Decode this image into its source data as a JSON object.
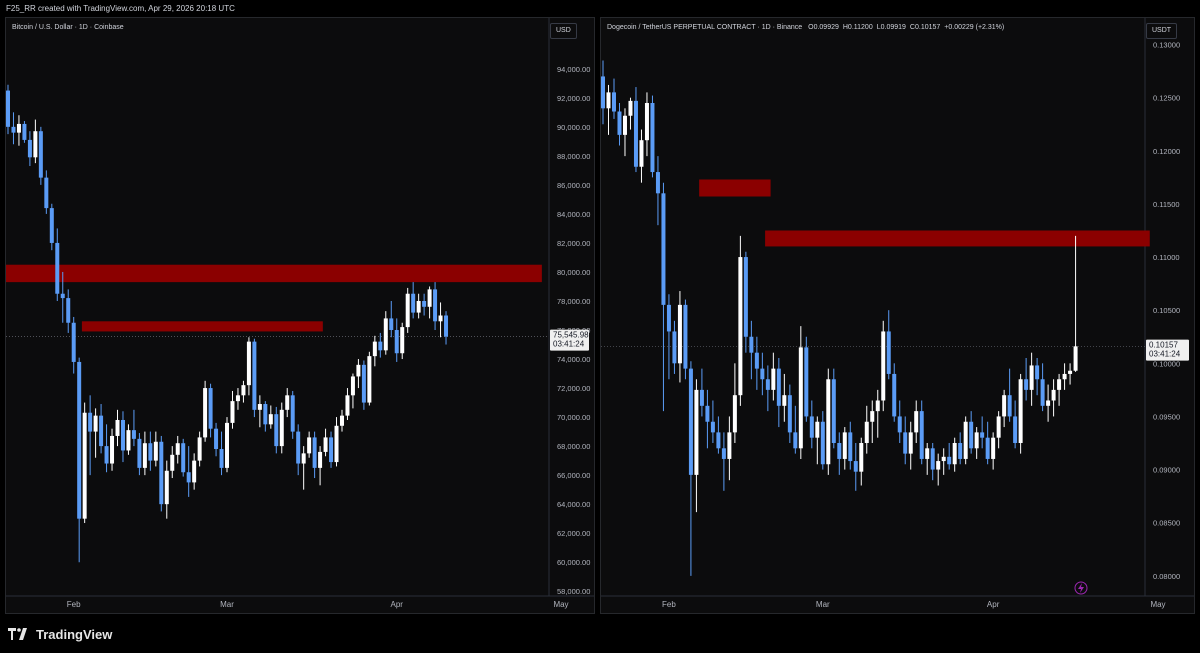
{
  "header": {
    "text": "F25_RR created with TradingView.com, Apr 29, 2026 20:18 UTC"
  },
  "footer": {
    "brand": "TradingView",
    "logo_icon": "tradingview-logo-icon"
  },
  "colors": {
    "up": "#ffffff",
    "down": "#5b9cf6",
    "zone": "#8b0000",
    "background": "#0c0c0d",
    "axis_text": "#b2b5be"
  },
  "chart_data": [
    {
      "type": "candlestick",
      "title": "Bitcoin / U.S. Dollar · 1D · Coinbase",
      "currency": "USD",
      "ylim": [
        56500,
        97500
      ],
      "y_ticks": [
        58000,
        60000,
        62000,
        64000,
        66000,
        68000,
        70000,
        72000,
        74000,
        76000,
        78000,
        80000,
        82000,
        84000,
        86000,
        88000,
        90000,
        92000,
        94000
      ],
      "y_tick_labels": [
        "58,000.00",
        "60,000.00",
        "62,000.00",
        "64,000.00",
        "66,000.00",
        "68,000.00",
        "70,000.00",
        "72,000.00",
        "74,000.00",
        "76,000.00",
        "78,000.00",
        "80,000.00",
        "82,000.00",
        "84,000.00",
        "86,000.00",
        "88,000.00",
        "90,000.00",
        "92,000.00",
        "94,000.00"
      ],
      "x_ticks": [
        {
          "date": "2026-02-01",
          "label": "Feb"
        },
        {
          "date": "2026-03-01",
          "label": "Mar"
        },
        {
          "date": "2026-04-01",
          "label": "Apr"
        },
        {
          "date": "2026-05-01",
          "label": "May"
        }
      ],
      "date_range": [
        "2026-01-20",
        "2026-05-01"
      ],
      "first_date": "2026-01-20",
      "last_price": {
        "value": 75545.98,
        "label": "75,545.98",
        "countdown": "03:41:24"
      },
      "zones": [
        {
          "from": "2026-01-20",
          "to": "2026-04-27",
          "low": 79300,
          "high": 80500
        },
        {
          "from": "2026-02-03",
          "to": "2026-03-18",
          "low": 75900,
          "high": 76600
        }
      ],
      "ohlc": [
        [
          92500,
          92900,
          89500,
          90000
        ],
        [
          90000,
          91000,
          88800,
          89600
        ],
        [
          89600,
          90800,
          88700,
          90200
        ],
        [
          90200,
          90400,
          88900,
          89100
        ],
        [
          89100,
          89700,
          87300,
          87900
        ],
        [
          87900,
          90500,
          87500,
          89700
        ],
        [
          89700,
          90000,
          86000,
          86500
        ],
        [
          86500,
          87000,
          84000,
          84400
        ],
        [
          84400,
          84700,
          81500,
          82000
        ],
        [
          82000,
          83000,
          78000,
          78500
        ],
        [
          78500,
          80000,
          76500,
          78200
        ],
        [
          78200,
          78800,
          75800,
          76500
        ],
        [
          76500,
          76900,
          73000,
          73800
        ],
        [
          73800,
          74100,
          60000,
          63000
        ],
        [
          63000,
          71000,
          62700,
          70300
        ],
        [
          70300,
          71500,
          66000,
          69000
        ],
        [
          69000,
          70600,
          67200,
          70100
        ],
        [
          70100,
          70900,
          67500,
          68000
        ],
        [
          68000,
          69500,
          66200,
          66800
        ],
        [
          66800,
          69200,
          66300,
          68700
        ],
        [
          68700,
          70500,
          68000,
          69800
        ],
        [
          69800,
          70400,
          66900,
          67700
        ],
        [
          67700,
          69500,
          67400,
          69100
        ],
        [
          69100,
          70500,
          68000,
          68500
        ],
        [
          68500,
          68900,
          66000,
          66500
        ],
        [
          66500,
          69000,
          66000,
          68200
        ],
        [
          68200,
          69000,
          66300,
          67000
        ],
        [
          67000,
          69000,
          66600,
          68300
        ],
        [
          68300,
          68700,
          63500,
          64000
        ],
        [
          64000,
          67000,
          63000,
          66300
        ],
        [
          66300,
          68000,
          65800,
          67400
        ],
        [
          67400,
          68700,
          66800,
          68200
        ],
        [
          68200,
          68500,
          65900,
          66200
        ],
        [
          66200,
          68000,
          64500,
          65500
        ],
        [
          65500,
          67500,
          65000,
          67000
        ],
        [
          67000,
          69000,
          66600,
          68600
        ],
        [
          68600,
          72500,
          68300,
          72000
        ],
        [
          72000,
          72300,
          68600,
          69200
        ],
        [
          69200,
          69600,
          67300,
          67800
        ],
        [
          67800,
          69000,
          66000,
          66500
        ],
        [
          66500,
          70000,
          66200,
          69600
        ],
        [
          69600,
          71800,
          69200,
          71100
        ],
        [
          71100,
          72000,
          70500,
          71500
        ],
        [
          71500,
          72500,
          71000,
          72200
        ],
        [
          72200,
          75500,
          71500,
          75200
        ],
        [
          75200,
          75400,
          70000,
          70500
        ],
        [
          70500,
          71500,
          69300,
          70900
        ],
        [
          70900,
          71100,
          69000,
          69500
        ],
        [
          69500,
          70800,
          69200,
          70200
        ],
        [
          70200,
          70700,
          67500,
          68000
        ],
        [
          68000,
          71000,
          67500,
          70500
        ],
        [
          70500,
          72000,
          70000,
          71500
        ],
        [
          71500,
          71800,
          68500,
          69000
        ],
        [
          69000,
          69500,
          66000,
          66800
        ],
        [
          66800,
          68000,
          65000,
          67500
        ],
        [
          67500,
          69000,
          67200,
          68600
        ],
        [
          68600,
          69000,
          65800,
          66500
        ],
        [
          66500,
          68000,
          65300,
          67600
        ],
        [
          67600,
          69200,
          67300,
          68600
        ],
        [
          68600,
          69000,
          66500,
          66900
        ],
        [
          66900,
          70000,
          66600,
          69400
        ],
        [
          69400,
          70500,
          69000,
          70100
        ],
        [
          70100,
          72000,
          69800,
          71500
        ],
        [
          71500,
          73000,
          70600,
          72800
        ],
        [
          72800,
          74000,
          72000,
          73600
        ],
        [
          73600,
          73900,
          70500,
          71000
        ],
        [
          71000,
          74500,
          70800,
          74200
        ],
        [
          74200,
          75600,
          73500,
          75200
        ],
        [
          75200,
          75800,
          74100,
          74600
        ],
        [
          74600,
          77300,
          74300,
          76800
        ],
        [
          76800,
          78000,
          75500,
          76000
        ],
        [
          76000,
          76800,
          73800,
          74400
        ],
        [
          74400,
          76500,
          74000,
          76200
        ],
        [
          76200,
          78900,
          75800,
          78500
        ],
        [
          78500,
          79300,
          76800,
          77200
        ],
        [
          77200,
          78500,
          76800,
          78000
        ],
        [
          78000,
          78500,
          77000,
          77600
        ],
        [
          77600,
          79000,
          76800,
          78800
        ],
        [
          78800,
          79300,
          76000,
          76600
        ],
        [
          76600,
          77900,
          75500,
          77000
        ],
        [
          77000,
          77300,
          75000,
          75546
        ]
      ]
    },
    {
      "type": "candlestick",
      "title": "Dogecoin / TetherUS PERPETUAL CONTRACT · 1D · Binance",
      "ohlc_text": [
        {
          "k": "O",
          "v": "0.09929"
        },
        {
          "k": "H",
          "v": "0.11200"
        },
        {
          "k": "L",
          "v": "0.09919"
        },
        {
          "k": "C",
          "v": "0.10157"
        },
        {
          "k": "chg",
          "v": "+0.00229 (+2.31%)"
        }
      ],
      "currency": "USDT",
      "ylim": [
        0.0765,
        0.1325
      ],
      "y_ticks": [
        0.08,
        0.085,
        0.09,
        0.095,
        0.1,
        0.105,
        0.11,
        0.115,
        0.12,
        0.125,
        0.13
      ],
      "y_tick_labels": [
        "0.08000",
        "0.08500",
        "0.09000",
        "0.09500",
        "0.10000",
        "0.10500",
        "0.11000",
        "0.11500",
        "0.12000",
        "0.12500",
        "0.13000"
      ],
      "x_ticks": [
        {
          "date": "2026-02-01",
          "label": "Feb"
        },
        {
          "date": "2026-03-01",
          "label": "Mar"
        },
        {
          "date": "2026-04-01",
          "label": "Apr"
        },
        {
          "date": "2026-05-01",
          "label": "May"
        }
      ],
      "date_range": [
        "2026-01-20",
        "2026-05-01"
      ],
      "first_date": "2026-01-20",
      "last_price": {
        "value": 0.10157,
        "label": "0.10157",
        "countdown": "03:41:24"
      },
      "alert_icon": "lightning-icon",
      "zones": [
        {
          "from": "2026-02-07",
          "to": "2026-02-19",
          "low": 0.1157,
          "high": 0.1173
        },
        {
          "from": "2026-02-19",
          "to": "2026-04-29",
          "low": 0.111,
          "high": 0.1125
        }
      ],
      "ohlc": [
        [
          0.127,
          0.1285,
          0.1225,
          0.124
        ],
        [
          0.124,
          0.1262,
          0.1215,
          0.1255
        ],
        [
          0.1255,
          0.1268,
          0.123,
          0.1237
        ],
        [
          0.1237,
          0.1245,
          0.1205,
          0.1215
        ],
        [
          0.1215,
          0.124,
          0.1195,
          0.1233
        ],
        [
          0.1233,
          0.125,
          0.122,
          0.1247
        ],
        [
          0.1247,
          0.126,
          0.118,
          0.1185
        ],
        [
          0.1185,
          0.122,
          0.117,
          0.121
        ],
        [
          0.121,
          0.1255,
          0.1195,
          0.1245
        ],
        [
          0.1245,
          0.1252,
          0.1175,
          0.118
        ],
        [
          0.118,
          0.1195,
          0.113,
          0.116
        ],
        [
          0.116,
          0.117,
          0.0955,
          0.1055
        ],
        [
          0.1055,
          0.1065,
          0.0985,
          0.103
        ],
        [
          0.103,
          0.104,
          0.099,
          0.1
        ],
        [
          0.1,
          0.1068,
          0.0982,
          0.1055
        ],
        [
          0.1055,
          0.106,
          0.0985,
          0.0995
        ],
        [
          0.0995,
          0.1002,
          0.08,
          0.0895
        ],
        [
          0.0895,
          0.0985,
          0.086,
          0.0975
        ],
        [
          0.0975,
          0.0995,
          0.095,
          0.096
        ],
        [
          0.096,
          0.0975,
          0.092,
          0.0945
        ],
        [
          0.0945,
          0.0965,
          0.0925,
          0.0935
        ],
        [
          0.0935,
          0.095,
          0.0915,
          0.092
        ],
        [
          0.092,
          0.0935,
          0.088,
          0.091
        ],
        [
          0.091,
          0.095,
          0.089,
          0.0935
        ],
        [
          0.0935,
          0.1,
          0.0925,
          0.097
        ],
        [
          0.097,
          0.112,
          0.096,
          0.11
        ],
        [
          0.11,
          0.1105,
          0.101,
          0.1025
        ],
        [
          0.1025,
          0.104,
          0.0985,
          0.101
        ],
        [
          0.101,
          0.1025,
          0.0975,
          0.0995
        ],
        [
          0.0995,
          0.101,
          0.097,
          0.0985
        ],
        [
          0.0985,
          0.0998,
          0.0955,
          0.0975
        ],
        [
          0.0975,
          0.101,
          0.0965,
          0.0995
        ],
        [
          0.0995,
          0.1005,
          0.094,
          0.096
        ],
        [
          0.096,
          0.099,
          0.0945,
          0.097
        ],
        [
          0.097,
          0.098,
          0.0925,
          0.0935
        ],
        [
          0.0935,
          0.096,
          0.0915,
          0.092
        ],
        [
          0.092,
          0.1035,
          0.091,
          0.1015
        ],
        [
          0.1015,
          0.1025,
          0.0945,
          0.095
        ],
        [
          0.095,
          0.0965,
          0.092,
          0.093
        ],
        [
          0.093,
          0.095,
          0.0905,
          0.0945
        ],
        [
          0.0945,
          0.0955,
          0.09,
          0.0905
        ],
        [
          0.0905,
          0.0995,
          0.0895,
          0.0985
        ],
        [
          0.0985,
          0.0995,
          0.092,
          0.0925
        ],
        [
          0.0925,
          0.0935,
          0.0895,
          0.091
        ],
        [
          0.091,
          0.094,
          0.09,
          0.0935
        ],
        [
          0.0935,
          0.0945,
          0.09,
          0.0908
        ],
        [
          0.0908,
          0.0925,
          0.088,
          0.0898
        ],
        [
          0.0898,
          0.093,
          0.0885,
          0.0925
        ],
        [
          0.0925,
          0.096,
          0.0915,
          0.0945
        ],
        [
          0.0945,
          0.0965,
          0.0925,
          0.0955
        ],
        [
          0.0955,
          0.0975,
          0.093,
          0.0965
        ],
        [
          0.0965,
          0.104,
          0.0955,
          0.103
        ],
        [
          0.103,
          0.105,
          0.0985,
          0.099
        ],
        [
          0.099,
          0.1,
          0.0945,
          0.095
        ],
        [
          0.095,
          0.0965,
          0.0925,
          0.0935
        ],
        [
          0.0935,
          0.095,
          0.0905,
          0.0915
        ],
        [
          0.0915,
          0.0945,
          0.09,
          0.0935
        ],
        [
          0.0935,
          0.0965,
          0.0925,
          0.0955
        ],
        [
          0.0955,
          0.0965,
          0.0905,
          0.091
        ],
        [
          0.091,
          0.0925,
          0.0895,
          0.092
        ],
        [
          0.092,
          0.0925,
          0.089,
          0.09
        ],
        [
          0.09,
          0.0915,
          0.0885,
          0.0908
        ],
        [
          0.0908,
          0.092,
          0.0895,
          0.0912
        ],
        [
          0.0912,
          0.0925,
          0.09,
          0.0905
        ],
        [
          0.0905,
          0.093,
          0.0898,
          0.0925
        ],
        [
          0.0925,
          0.0935,
          0.0905,
          0.091
        ],
        [
          0.091,
          0.095,
          0.0905,
          0.0945
        ],
        [
          0.0945,
          0.0955,
          0.0915,
          0.092
        ],
        [
          0.092,
          0.094,
          0.091,
          0.0935
        ],
        [
          0.0935,
          0.095,
          0.092,
          0.093
        ],
        [
          0.093,
          0.0945,
          0.0905,
          0.091
        ],
        [
          0.091,
          0.0935,
          0.09,
          0.093
        ],
        [
          0.093,
          0.0955,
          0.092,
          0.095
        ],
        [
          0.095,
          0.0975,
          0.094,
          0.097
        ],
        [
          0.097,
          0.0995,
          0.0945,
          0.095
        ],
        [
          0.095,
          0.0965,
          0.092,
          0.0925
        ],
        [
          0.0925,
          0.099,
          0.0915,
          0.0985
        ],
        [
          0.0985,
          0.1005,
          0.0965,
          0.0975
        ],
        [
          0.0975,
          0.101,
          0.096,
          0.0998
        ],
        [
          0.0998,
          0.1005,
          0.097,
          0.0985
        ],
        [
          0.0985,
          0.1,
          0.0955,
          0.096
        ],
        [
          0.096,
          0.098,
          0.0945,
          0.0965
        ],
        [
          0.0965,
          0.0985,
          0.095,
          0.0975
        ],
        [
          0.0975,
          0.099,
          0.096,
          0.0985
        ],
        [
          0.0985,
          0.1,
          0.0975,
          0.099
        ],
        [
          0.099,
          0.1,
          0.098,
          0.0993
        ],
        [
          0.0993,
          0.112,
          0.0992,
          0.1016
        ]
      ]
    }
  ]
}
